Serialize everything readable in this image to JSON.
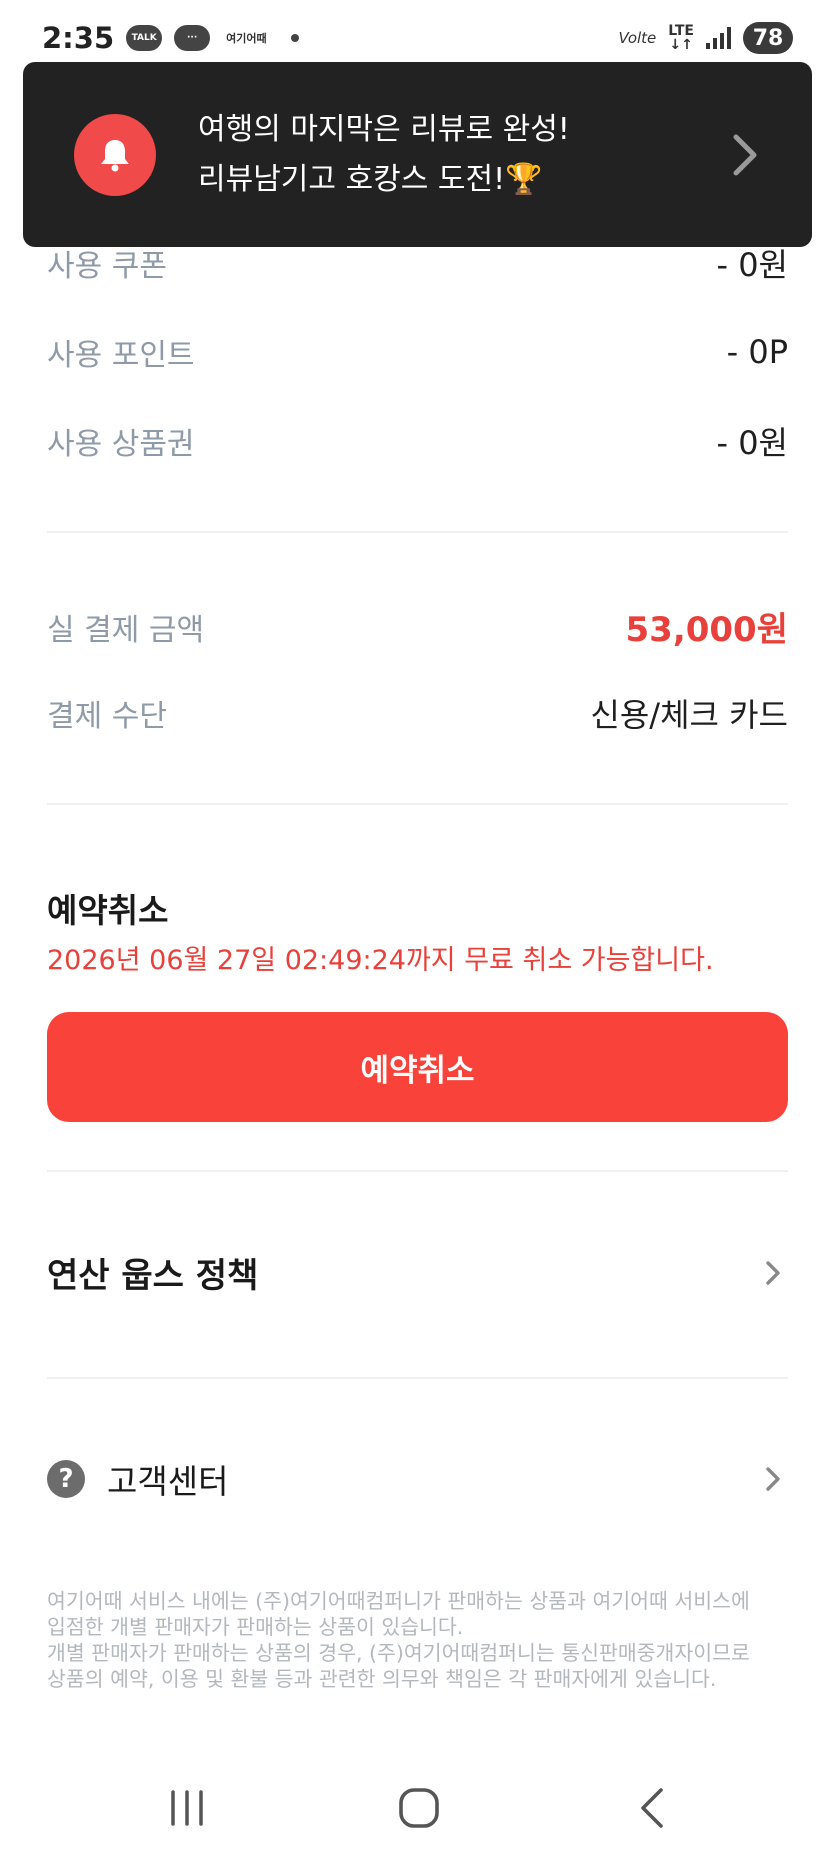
{
  "status_bar": {
    "time": "2:35",
    "chips": [
      "TALK",
      "···",
      "여기어때"
    ],
    "volte": "Volte",
    "lte": "LTE",
    "battery": "78"
  },
  "toast": {
    "line1": "여행의 마지막은 리뷰로 완성!",
    "line2": "리뷰남기고 호캉스 도전!🏆",
    "bell_color": "#f04a4a"
  },
  "payment": {
    "coupon_label": "사용 쿠폰",
    "coupon_value": "- 0원",
    "point_label": "사용 포인트",
    "point_value": "- 0P",
    "voucher_label": "사용 상품권",
    "voucher_value": "- 0원",
    "total_label": "실 결제 금액",
    "total_value": "53,000원",
    "method_label": "결제 수단",
    "method_value": "신용/체크 카드"
  },
  "cancellation": {
    "title": "예약취소",
    "note": "2026년 06월 27일 02:49:24까지 무료 취소 가능합니다.",
    "button_label": "예약취소",
    "button_color": "#f9423a"
  },
  "policy": {
    "label": "연산 웁스 정책"
  },
  "customer_center": {
    "label": "고객센터",
    "icon": "?"
  },
  "disclaimer": {
    "line1": "여기어때 서비스 내에는 (주)여기어때컴퍼니가 판매하는 상품과 여기어때 서비스에",
    "line2": "입점한 개별 판매자가 판매하는 상품이 있습니다.",
    "line3": "개별 판매자가 판매하는 상품의 경우, (주)여기어때컴퍼니는 통신판매중개자이므로",
    "line4": "상품의 예약, 이용 및 환불 등과 관련한 의무와 책임은 각 판매자에게 있습니다."
  },
  "colors": {
    "accent": "#e8403a",
    "label_gray": "#8e9aa8"
  }
}
